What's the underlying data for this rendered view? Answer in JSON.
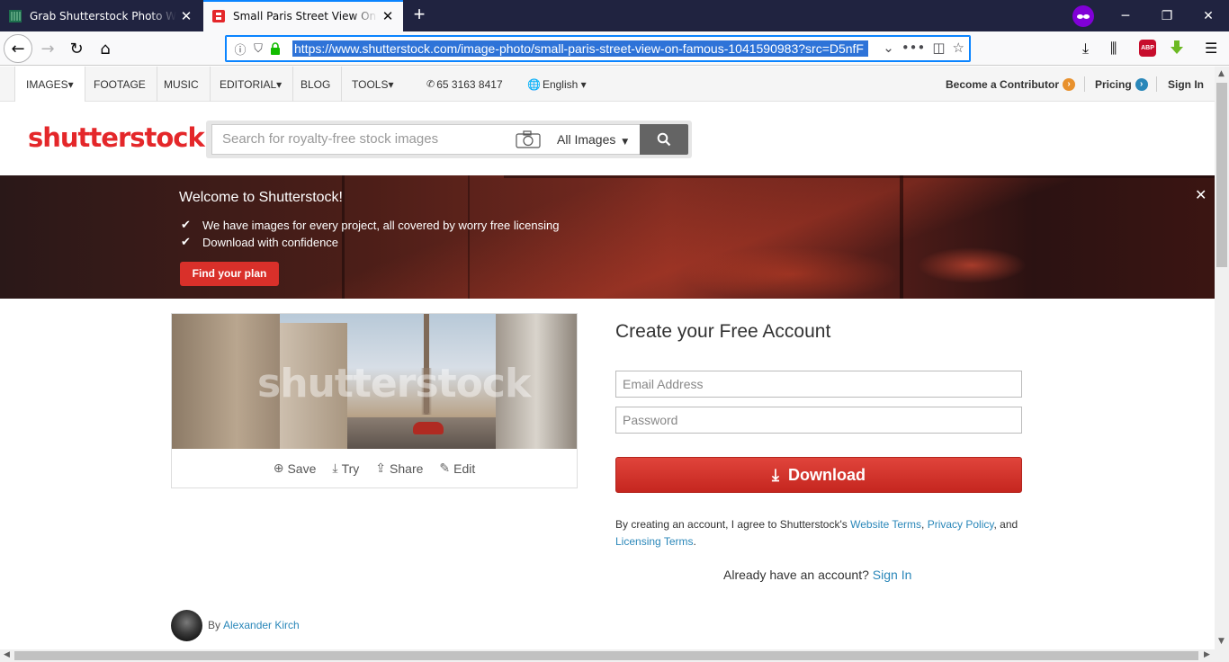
{
  "browser": {
    "tabs": [
      {
        "title": "Grab Shutterstock Photo Witho",
        "active": false
      },
      {
        "title": "Small Paris Street View On Fam",
        "active": true
      }
    ],
    "url": "https://www.shutterstock.com/image-photo/small-paris-street-view-on-famous-1041590983?src=D5nfF",
    "accent": "#0a84ff"
  },
  "topnav": {
    "items": [
      "IMAGES▾",
      "FOOTAGE",
      "MUSIC",
      "EDITORIAL▾",
      "BLOG",
      "TOOLS▾"
    ],
    "phone": "65 3163 8417",
    "language": "English ▾",
    "contributor": "Become a Contributor",
    "pricing": "Pricing",
    "signin": "Sign In"
  },
  "header": {
    "logo": "shutterstock",
    "search_placeholder": "Search for royalty-free stock images",
    "filter": "All Images",
    "brand_color": "#e4272a"
  },
  "banner": {
    "title": "Welcome to Shutterstock!",
    "bullets": [
      "We have images for every project, all covered by worry free licensing",
      "Download with confidence"
    ],
    "cta": "Find your plan"
  },
  "photo": {
    "watermark": "shutterstock",
    "actions": {
      "save": "Save",
      "try": "Try",
      "share": "Share",
      "edit": "Edit"
    }
  },
  "account": {
    "title": "Create your Free Account",
    "email_placeholder": "Email Address",
    "password_placeholder": "Password",
    "download": "Download",
    "terms_prefix": "By creating an account, I agree to Shutterstock's ",
    "website_terms": "Website Terms",
    "comma": ", ",
    "privacy_policy": "Privacy Policy",
    "and": ", and",
    "licensing_terms": "Licensing Terms",
    "period": ".",
    "already": "Already have an account?",
    "signin": "Sign In"
  },
  "byline": {
    "prefix": "By",
    "author": "Alexander Kirch"
  }
}
